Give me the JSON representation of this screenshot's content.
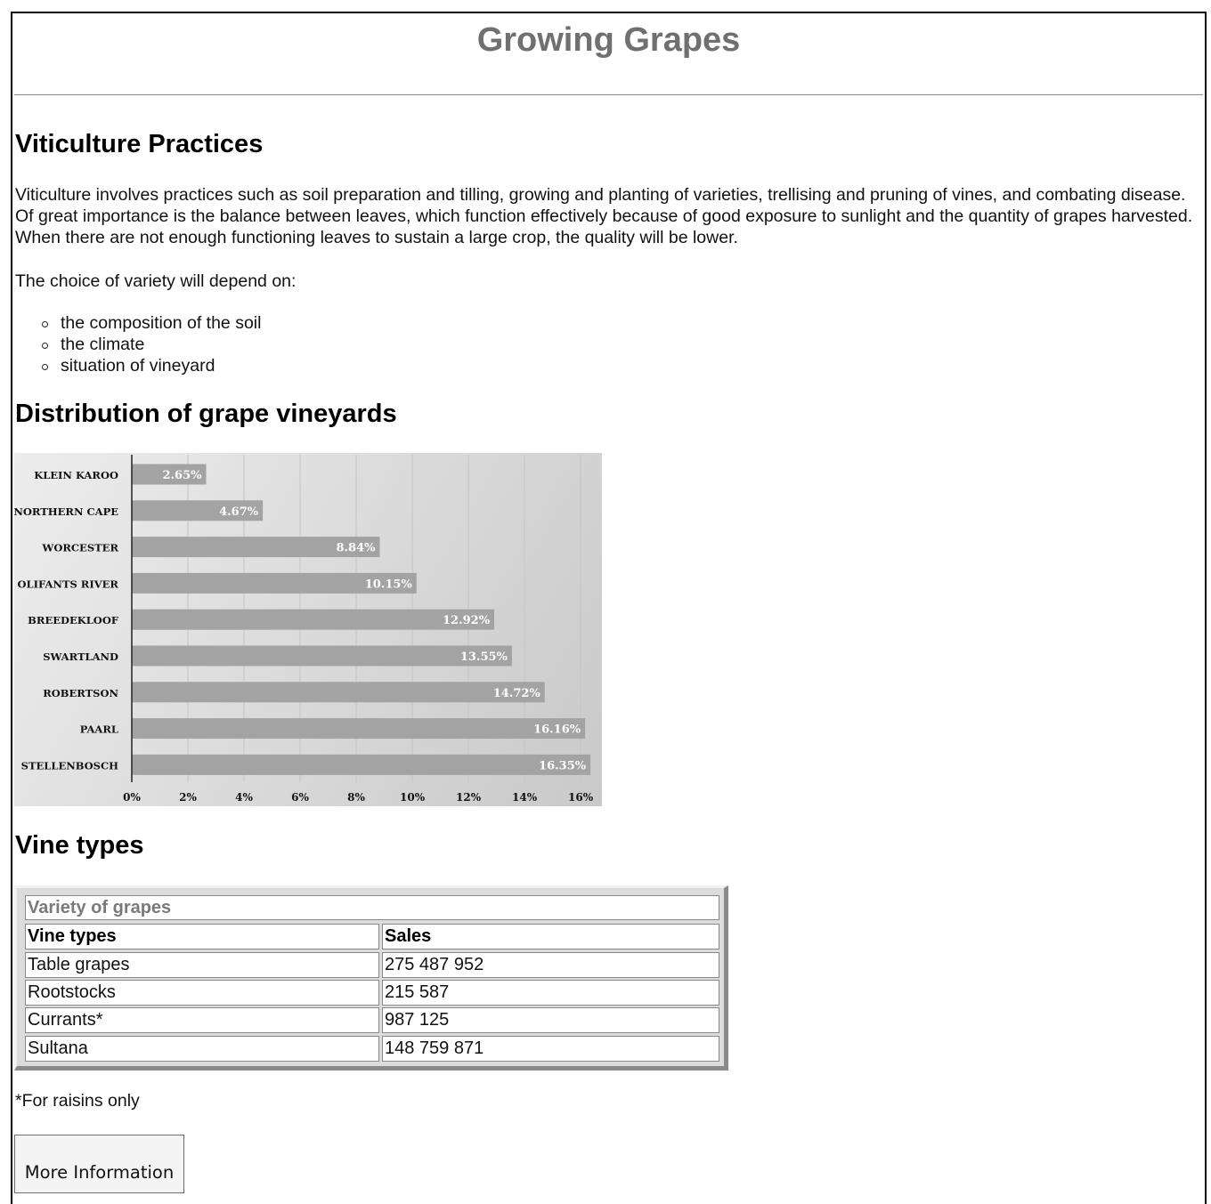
{
  "page": {
    "title": "Growing Grapes"
  },
  "viticulture": {
    "heading": "Viticulture Practices",
    "paragraph": "Viticulture involves practices such as soil preparation and tilling, growing and planting of varieties, trellising and pruning of vines, and combating disease. Of great importance is the balance between leaves, which function effectively because of good exposure to sunlight and the quantity of grapes harvested. When there are not enough functioning leaves to sustain a large crop, the quality will be lower.",
    "choice_intro": "The choice of variety will depend on:",
    "choices": [
      "the composition of the soil",
      "the climate",
      "situation of vineyard"
    ]
  },
  "distribution": {
    "heading": "Distribution of grape vineyards"
  },
  "chart_data": {
    "type": "bar",
    "orientation": "horizontal",
    "categories": [
      "KLEIN KAROO",
      "NORTHERN CAPE",
      "WORCESTER",
      "OLIFANTS RIVER",
      "BREEDEKLOOF",
      "SWARTLAND",
      "ROBERTSON",
      "PAARL",
      "STELLENBOSCH"
    ],
    "values": [
      2.65,
      4.67,
      8.84,
      10.15,
      12.92,
      13.55,
      14.72,
      16.16,
      16.35
    ],
    "data_labels": [
      "2.65%",
      "4.67%",
      "8.84%",
      "10.15%",
      "12.92%",
      "13.55%",
      "14.72%",
      "16.16%",
      "16.35%"
    ],
    "x_ticks": [
      "0%",
      "2%",
      "4%",
      "6%",
      "8%",
      "10%",
      "12%",
      "14%",
      "16%"
    ],
    "xlim": [
      0,
      16.6
    ],
    "title": "",
    "xlabel": "",
    "ylabel": "",
    "grid": true,
    "legend": "none",
    "colors": {
      "bar": "#a3a3a3",
      "label": "#ffffff",
      "axis": "#222222"
    }
  },
  "vine_types": {
    "heading": "Vine types",
    "caption": "Variety of grapes",
    "columns": [
      "Vine types",
      "Sales"
    ],
    "rows": [
      [
        "Table grapes",
        "275 487 952"
      ],
      [
        "Rootstocks",
        "215 587"
      ],
      [
        "Currants*",
        "987 125"
      ],
      [
        "Sultana",
        "148 759 871"
      ]
    ],
    "footnote": "*For raisins only"
  },
  "more_button": {
    "label": "More Information"
  }
}
